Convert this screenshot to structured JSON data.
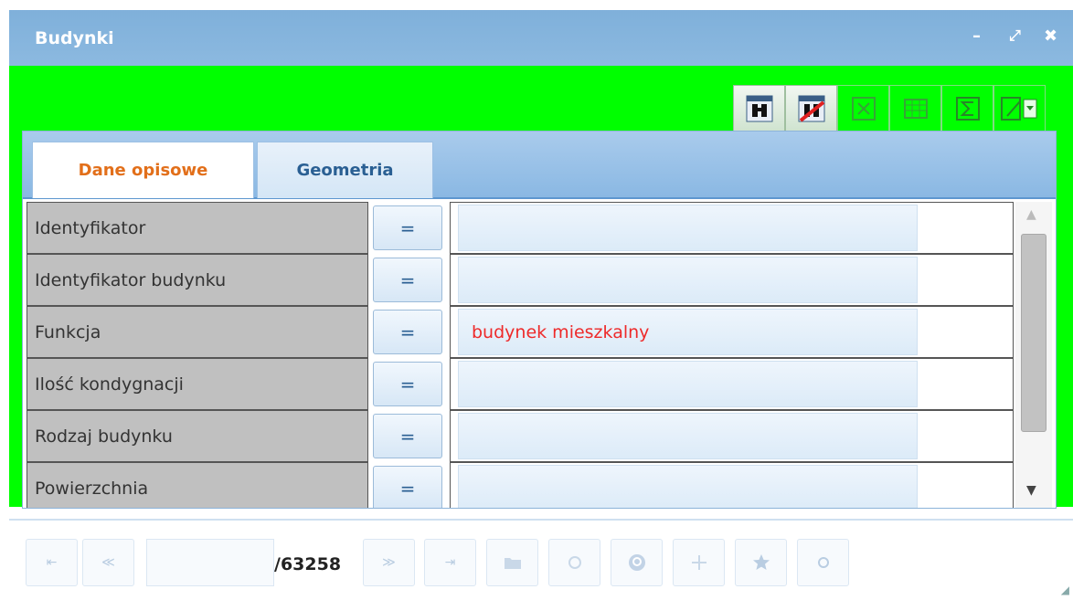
{
  "window": {
    "title": "Budynki",
    "controls": {
      "minimize": "–",
      "restore": "⤢",
      "close": "✖"
    }
  },
  "toolbar": {
    "buttons": [
      {
        "icon": "search-binoculars-icon",
        "enabled": true
      },
      {
        "icon": "clear-search-icon",
        "enabled": true
      },
      {
        "icon": "excel-export-icon",
        "enabled": false
      },
      {
        "icon": "table-icon",
        "enabled": false
      },
      {
        "icon": "sum-icon",
        "enabled": false
      },
      {
        "icon": "edit-dropdown-icon",
        "enabled": false
      }
    ]
  },
  "tabs": {
    "active": "Dane opisowe",
    "inactive": "Geometria"
  },
  "fields": [
    {
      "label": "Identyfikator",
      "op": "=",
      "value": ""
    },
    {
      "label": "Identyfikator budynku",
      "op": "=",
      "value": ""
    },
    {
      "label": "Funkcja",
      "op": "=",
      "value": "budynek mieszkalny"
    },
    {
      "label": "Ilość kondygnacji",
      "op": "=",
      "value": ""
    },
    {
      "label": "Rodzaj budynku",
      "op": "=",
      "value": ""
    },
    {
      "label": "Powierzchnia",
      "op": "=",
      "value": ""
    }
  ],
  "pager": {
    "first": "⇤",
    "prev": "≪",
    "page": "",
    "total": "/63258",
    "next": "≫",
    "last": "⇥",
    "tools": [
      "folder-icon",
      "refresh-icon",
      "zoom-icon",
      "move-icon",
      "star-icon",
      "circle-icon"
    ]
  },
  "colors": {
    "accent_green": "#00ff00",
    "title_blue": "#8cb9e0",
    "active_tab": "#e26f1a",
    "value_red": "#ee2a2a"
  }
}
